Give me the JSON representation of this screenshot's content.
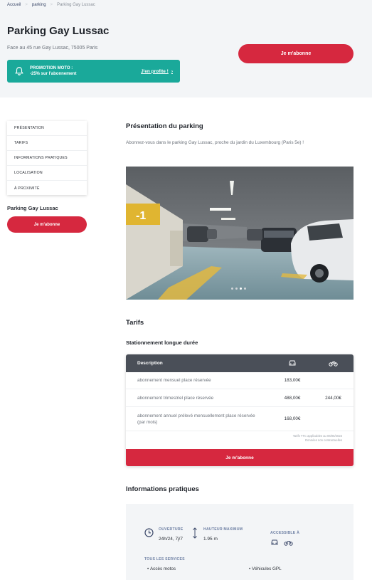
{
  "breadcrumb": {
    "items": [
      "Accueil",
      "parking",
      "Parking Gay Lussac"
    ],
    "separator": ">"
  },
  "header": {
    "title": "Parking Gay Lussac",
    "address": "Face au 45 rue Gay Lussac, 75005 Paris",
    "promo": {
      "line1": "PROMOTION MOTO :",
      "line2": "-25% sur l'abonnement",
      "link": "J'en profite !",
      "link_icon": "chevron-right-icon",
      "icon": "bell-icon",
      "color": "#1aa99a"
    },
    "cta": "Je m'abonne"
  },
  "sidebar": {
    "items": [
      {
        "label": "PRÉSENTATION"
      },
      {
        "label": "TARIFS"
      },
      {
        "label": "INFORMATIONS PRATIQUES"
      },
      {
        "label": "LOCALISATION"
      },
      {
        "label": "À PROXIMITÉ"
      }
    ],
    "parking_name": "Parking Gay Lussac",
    "cta": "Je m'abonne"
  },
  "presentation": {
    "title": "Présentation du parking",
    "text": "Abonnez-vous dans le parking Gay Lussac, proche du jardin du Luxembourg (Paris 5e) !",
    "carousel": {
      "slides": 4,
      "active": 3
    }
  },
  "tarifs": {
    "title": "Tarifs",
    "subtitle": "Stationnement longue durée",
    "columns": {
      "description": "Description",
      "car_icon": "car-icon",
      "moto_icon": "motorcycle-icon"
    },
    "rows": [
      {
        "description": "abonnement mensuel place réservée",
        "car": "183,00€",
        "moto": ""
      },
      {
        "description": "abonnement trimestriel place réservée",
        "car": "488,00€",
        "moto": "244,00€"
      },
      {
        "description": "abonnement annuel prélevé mensuellement place réservée (par mois)",
        "car": "168,00€",
        "moto": ""
      }
    ],
    "note1": "Tarifs TTC applicables au 06/05/2023",
    "note2": "Données non contractuelles",
    "cta": "Je m'abonne"
  },
  "infos": {
    "title": "Informations pratiques",
    "opening_label": "OUVERTURE",
    "opening_value": "24h/24, 7j/7",
    "height_label": "HAUTEUR MAXIMUM",
    "height_value": "1.95 m",
    "access_label": "ACCESSIBLE À",
    "services_label": "TOUS LES SERVICES",
    "services": [
      "Accès motos",
      "Véhicules GPL"
    ]
  },
  "colors": {
    "accent": "#d6283f",
    "promo": "#1aa99a",
    "table_header": "#4a4f58",
    "background_soft": "#f3f5f7"
  }
}
